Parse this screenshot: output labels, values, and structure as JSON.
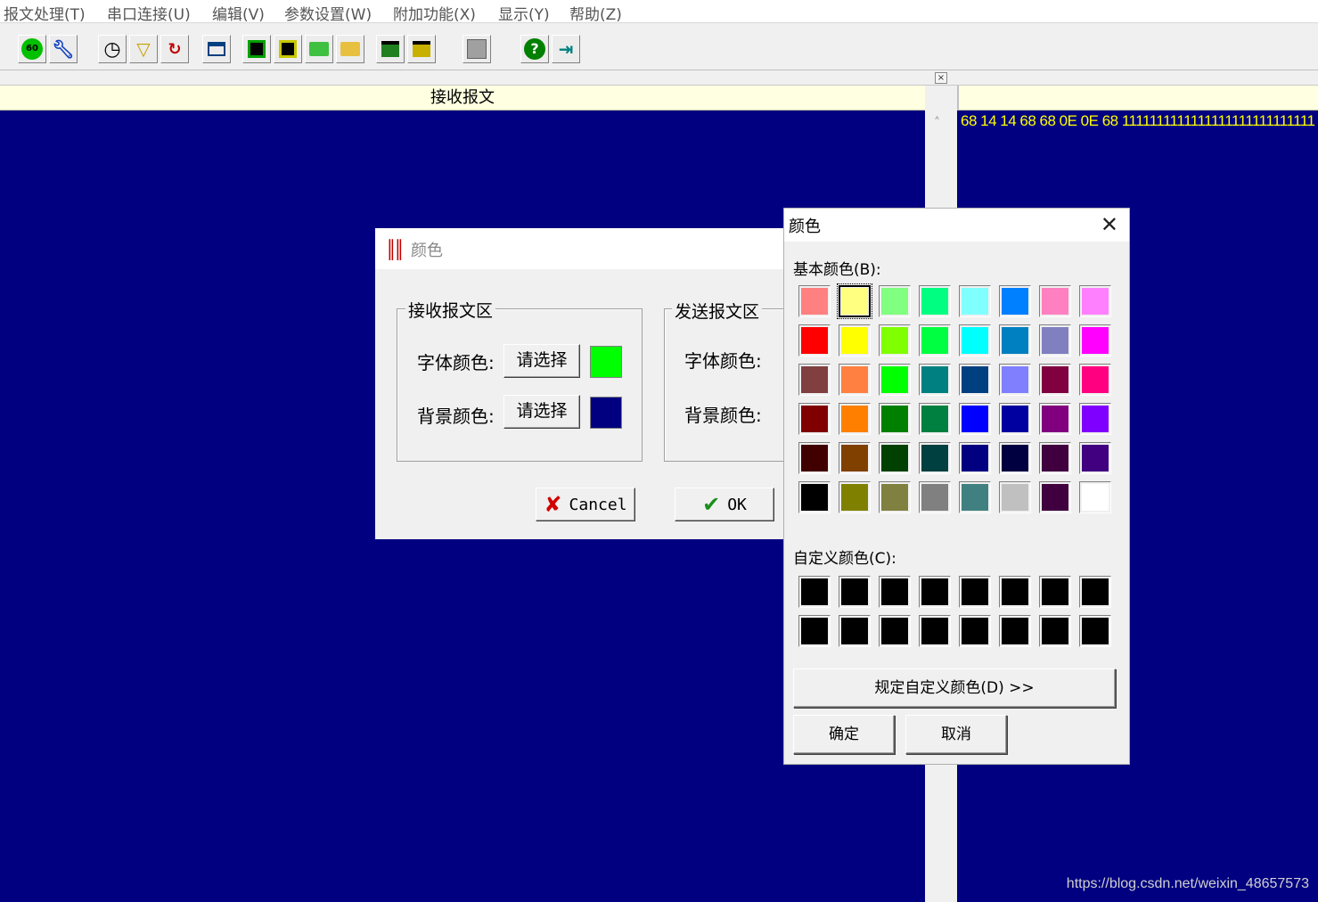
{
  "menu": [
    "报文处理(T)",
    "串口连接(U)",
    "编辑(V)",
    "参数设置(W)",
    "附加功能(X)",
    "显示(Y)",
    "帮助(Z)"
  ],
  "toolbar": {
    "icons": [
      "connect-icon",
      "settings-wrench-icon",
      "timer-icon",
      "filter-icon",
      "search-refresh-icon",
      "window-icon",
      "save-icon",
      "save-as-icon",
      "open-green-icon",
      "open-folder-icon",
      "export-icon",
      "import-icon",
      "stop-icon",
      "help-icon",
      "exit-icon"
    ],
    "connect_label": "60"
  },
  "subbar": {
    "close_glyph": "×"
  },
  "receive_pane": {
    "title": "接收报文"
  },
  "send_pane": {
    "hex_text": "68 14 14 68 68 0E 0E 68 1111111111111111111111111111"
  },
  "app_dialog": {
    "title": "颜色",
    "receive_group": {
      "label": "接收报文区",
      "font_color_label": "字体颜色:",
      "bg_color_label": "背景颜色:",
      "choose_label": "请选择",
      "font_color": "#00ff00",
      "bg_color": "#000080"
    },
    "send_group": {
      "label": "发送报文区",
      "font_color_label": "字体颜色:",
      "bg_color_label": "背景颜色:"
    },
    "cancel_label": "Cancel",
    "ok_label": "OK"
  },
  "color_dialog": {
    "title": "颜色",
    "basic_label": "基本颜色(B):",
    "custom_label": "自定义颜色(C):",
    "define_custom_label": "规定自定义颜色(D) >>",
    "ok_label": "确定",
    "cancel_label": "取消",
    "selected_index": 1,
    "basic_colors": [
      "#ff8080",
      "#ffff80",
      "#80ff80",
      "#00ff80",
      "#80ffff",
      "#0080ff",
      "#ff80c0",
      "#ff80ff",
      "#ff0000",
      "#ffff00",
      "#80ff00",
      "#00ff40",
      "#00ffff",
      "#0080c0",
      "#8080c0",
      "#ff00ff",
      "#804040",
      "#ff8040",
      "#00ff00",
      "#008080",
      "#004080",
      "#8080ff",
      "#800040",
      "#ff0080",
      "#800000",
      "#ff8000",
      "#008000",
      "#008040",
      "#0000ff",
      "#0000a0",
      "#800080",
      "#8000ff",
      "#400000",
      "#804000",
      "#004000",
      "#004040",
      "#000080",
      "#000040",
      "#400040",
      "#400080",
      "#000000",
      "#808000",
      "#808040",
      "#808080",
      "#408080",
      "#c0c0c0",
      "#400040",
      "#ffffff"
    ],
    "custom_colors": [
      "#000000",
      "#000000",
      "#000000",
      "#000000",
      "#000000",
      "#000000",
      "#000000",
      "#000000",
      "#000000",
      "#000000",
      "#000000",
      "#000000",
      "#000000",
      "#000000",
      "#000000",
      "#000000"
    ]
  },
  "watermark": "https://blog.csdn.net/weixin_48657573"
}
